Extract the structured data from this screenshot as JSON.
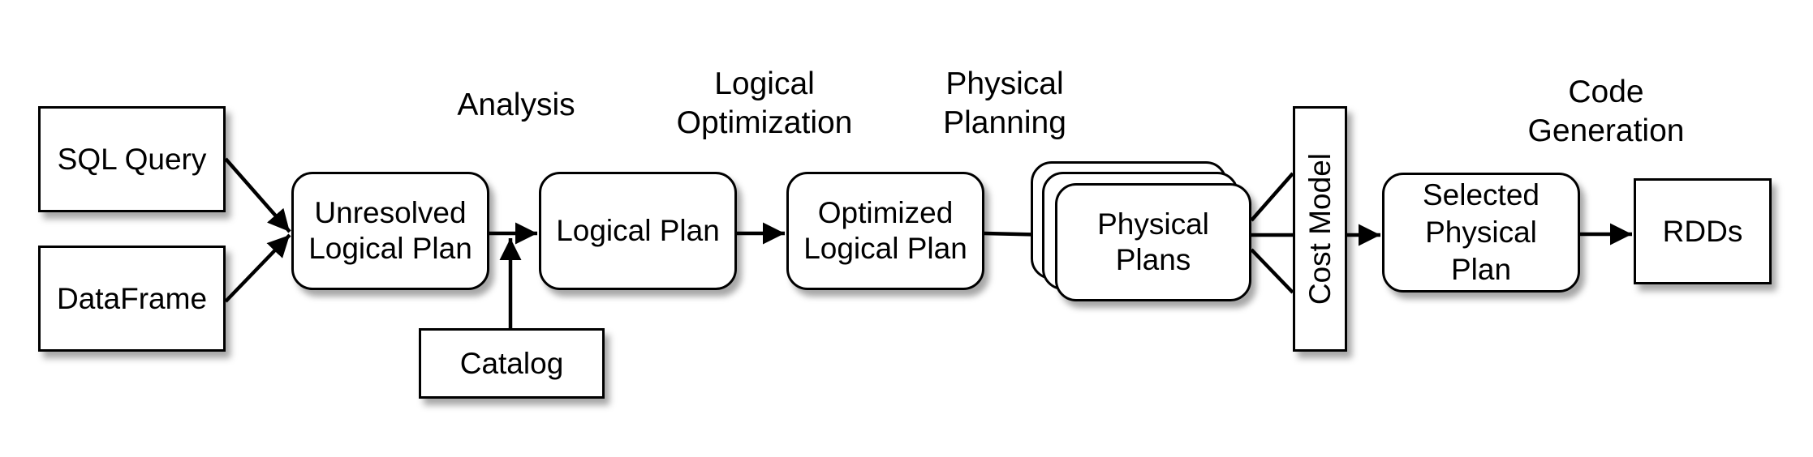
{
  "diagram": {
    "inputs": [
      "SQL Query",
      "DataFrame"
    ],
    "stages": {
      "analysis": "Analysis",
      "logical_optimization": "Logical\nOptimization",
      "physical_planning": "Physical\nPlanning",
      "code_generation": "Code\nGeneration"
    },
    "nodes": {
      "sql_query": "SQL Query",
      "dataframe": "DataFrame",
      "unresolved_logical_plan": "Unresolved\nLogical Plan",
      "catalog": "Catalog",
      "logical_plan": "Logical Plan",
      "optimized_logical_plan": "Optimized\nLogical Plan",
      "physical_plans": "Physical\nPlans",
      "cost_model": "Cost Model",
      "selected_physical_plan": "Selected\nPhysical\nPlan",
      "rdds": "RDDs"
    },
    "edges": [
      {
        "from": "SQL Query",
        "to": "Unresolved Logical Plan"
      },
      {
        "from": "DataFrame",
        "to": "Unresolved Logical Plan"
      },
      {
        "from": "Unresolved Logical Plan",
        "to": "Logical Plan"
      },
      {
        "from": "Catalog",
        "to": "Logical Plan"
      },
      {
        "from": "Logical Plan",
        "to": "Optimized Logical Plan"
      },
      {
        "from": "Optimized Logical Plan",
        "to": "Physical Plans"
      },
      {
        "from": "Physical Plans",
        "to": "Cost Model"
      },
      {
        "from": "Cost Model",
        "to": "Selected Physical Plan"
      },
      {
        "from": "Selected Physical Plan",
        "to": "RDDs"
      }
    ]
  }
}
